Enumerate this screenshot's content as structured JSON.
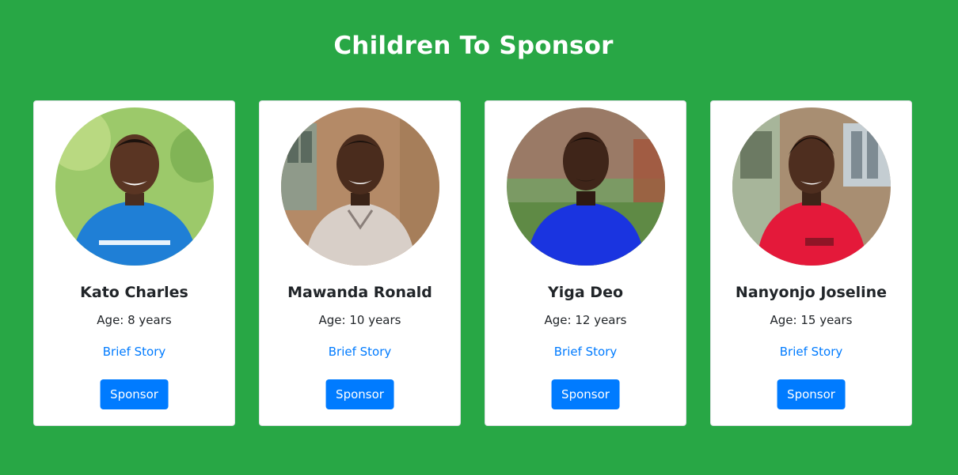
{
  "page": {
    "title": "Children To Sponsor"
  },
  "children": [
    {
      "name": "Kato Charles",
      "age": "Age: 8 years",
      "story_label": "Brief Story",
      "button_label": "Sponsor",
      "bg_color": "#9cc96a",
      "shirt_color": "#1f7fd6"
    },
    {
      "name": "Mawanda Ronald",
      "age": "Age: 10 years",
      "story_label": "Brief Story",
      "button_label": "Sponsor",
      "bg_color": "#b48a67",
      "shirt_color": "#d8cfc8"
    },
    {
      "name": "Yiga Deo",
      "age": "Age: 12 years",
      "story_label": "Brief Story",
      "button_label": "Sponsor",
      "bg_color": "#7b9a64",
      "shirt_color": "#1a34e0"
    },
    {
      "name": "Nanyonjo Joseline",
      "age": "Age: 15 years",
      "story_label": "Brief Story",
      "button_label": "Sponsor",
      "bg_color": "#a88e72",
      "shirt_color": "#e4193a"
    }
  ]
}
